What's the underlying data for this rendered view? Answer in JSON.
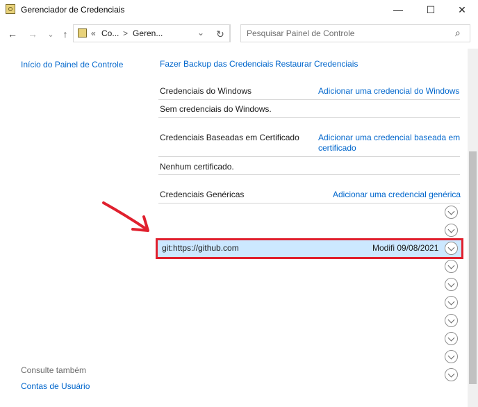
{
  "window": {
    "title": "Gerenciador de Credenciais",
    "minimize_glyph": "—",
    "maximize_glyph": "☐",
    "close_glyph": "✕"
  },
  "nav": {
    "back_glyph": "←",
    "forward_glyph": "→",
    "recent_glyph": "⌄",
    "up_glyph": "↑",
    "refresh_glyph": "↻",
    "dropdown_glyph": "⌄"
  },
  "address": {
    "overflow": "«",
    "crumb1": "Co...",
    "sep": ">",
    "crumb2": "Geren..."
  },
  "search": {
    "placeholder": "Pesquisar Painel de Controle",
    "icon_glyph": "⌕"
  },
  "sidebar": {
    "home": "Início do Painel de Controle",
    "see_also": "Consulte também",
    "user_accounts": "Contas de Usuário"
  },
  "toolbar": {
    "backup": "Fazer Backup das Credenciais",
    "restore": "Restaurar Credenciais"
  },
  "sections": {
    "windows": {
      "title": "Credenciais do Windows",
      "action": "Adicionar uma credencial do Windows",
      "empty": "Sem credenciais do Windows."
    },
    "certificate": {
      "title": "Credenciais Baseadas em Certificado",
      "action_line1": "Adicionar uma credencial baseada em",
      "action_line2": "certificado",
      "empty": "Nenhum certificado."
    },
    "generic": {
      "title": "Credenciais Genéricas",
      "action": "Adicionar uma credencial genérica",
      "highlighted_name": "git:https://github.com",
      "highlighted_modified": "Modifi 09/08/2021"
    }
  },
  "colors": {
    "link": "#0066cc",
    "highlight_border": "#e0202e",
    "row_selected": "#cce8ff"
  }
}
